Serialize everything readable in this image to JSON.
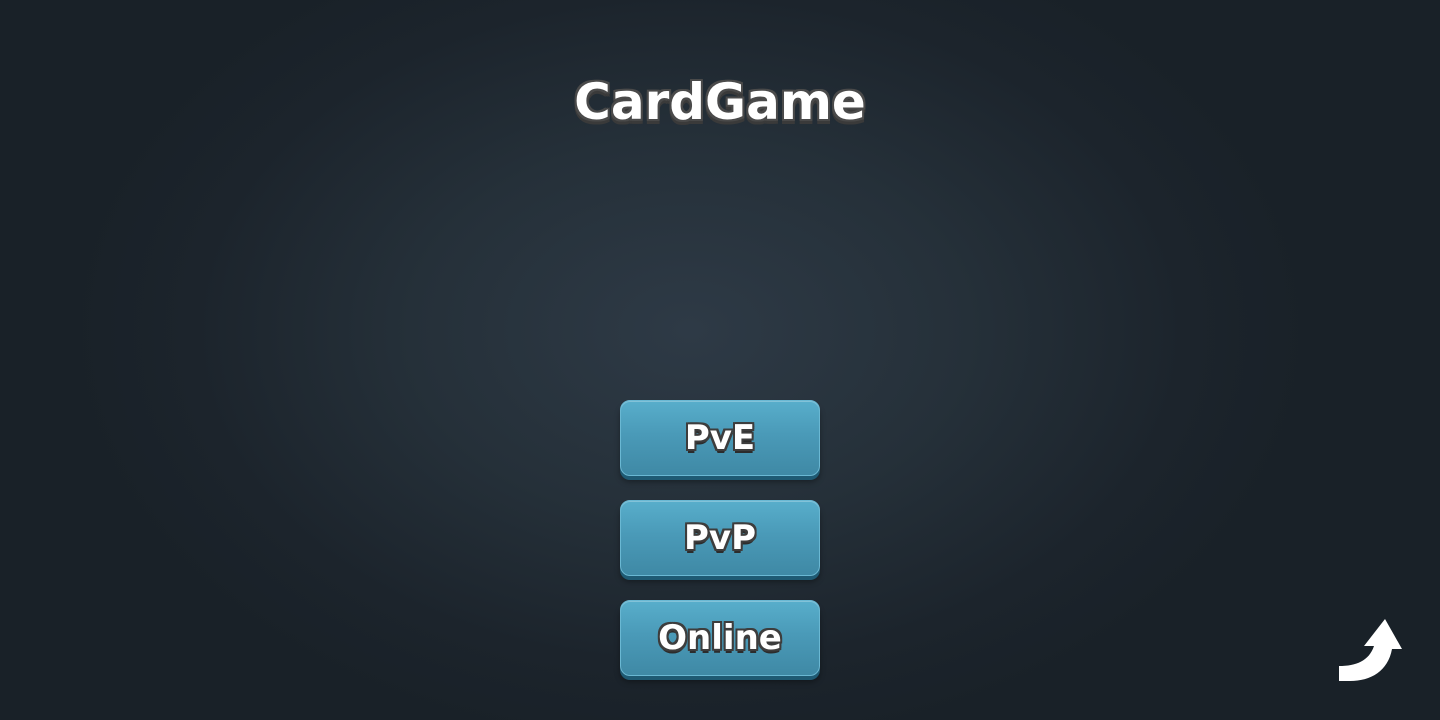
{
  "title": "CardGame",
  "menu": {
    "buttons": [
      {
        "label": "PvE"
      },
      {
        "label": "PvP"
      },
      {
        "label": "Online"
      }
    ]
  },
  "corner_button": {
    "icon": "share-arrow-icon"
  },
  "colors": {
    "button_fill": "#4a9ab8",
    "button_shadow": "#1e5a73",
    "background": "#253039",
    "text": "#ffffff",
    "text_outline": "#3d3d3d"
  }
}
